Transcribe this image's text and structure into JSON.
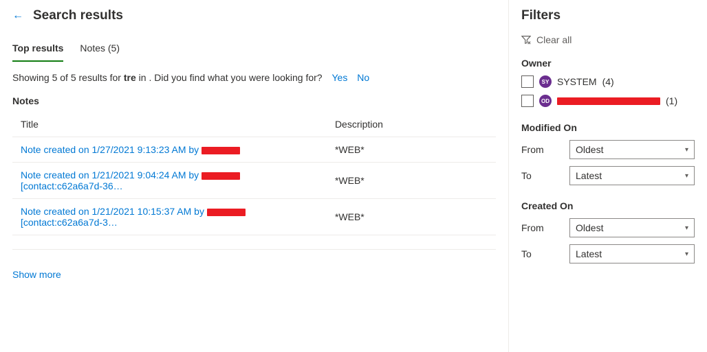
{
  "header": {
    "title": "Search results"
  },
  "tabs": [
    {
      "label": "Top results",
      "active": true
    },
    {
      "label": "Notes (5)",
      "active": false
    }
  ],
  "summary": {
    "prefix": "Showing 5 of 5 results for ",
    "term": "tre",
    "mid": " in . Did you find what you were looking for?",
    "yes": "Yes",
    "no": "No"
  },
  "notes": {
    "section_label": "Notes",
    "columns": {
      "title": "Title",
      "description": "Description"
    },
    "rows": [
      {
        "title_pre": "Note created on 1/27/2021 9:13:23 AM by ",
        "redact_w": 56,
        "title_post": "",
        "description": "*WEB*"
      },
      {
        "title_pre": "Note created on 1/21/2021 9:04:24 AM by ",
        "redact_w": 56,
        "title_post": "[contact:c62a6a7d-36…",
        "description": "*WEB*"
      },
      {
        "title_pre": "Note created on 1/21/2021 10:15:37 AM by ",
        "redact_w": 56,
        "title_post": " [contact:c62a6a7d-3…",
        "description": "*WEB*"
      }
    ],
    "show_more": "Show more"
  },
  "filters": {
    "title": "Filters",
    "clear_all": "Clear all",
    "owner": {
      "label": "Owner",
      "items": [
        {
          "initials": "SY",
          "name": "SYSTEM",
          "count": "(4)",
          "redacted": false
        },
        {
          "initials": "OD",
          "name": "",
          "count": "(1)",
          "redacted": true
        }
      ]
    },
    "modified_on": {
      "label": "Modified On",
      "from_label": "From",
      "from_value": "Oldest",
      "to_label": "To",
      "to_value": "Latest"
    },
    "created_on": {
      "label": "Created On",
      "from_label": "From",
      "from_value": "Oldest",
      "to_label": "To",
      "to_value": "Latest"
    }
  }
}
